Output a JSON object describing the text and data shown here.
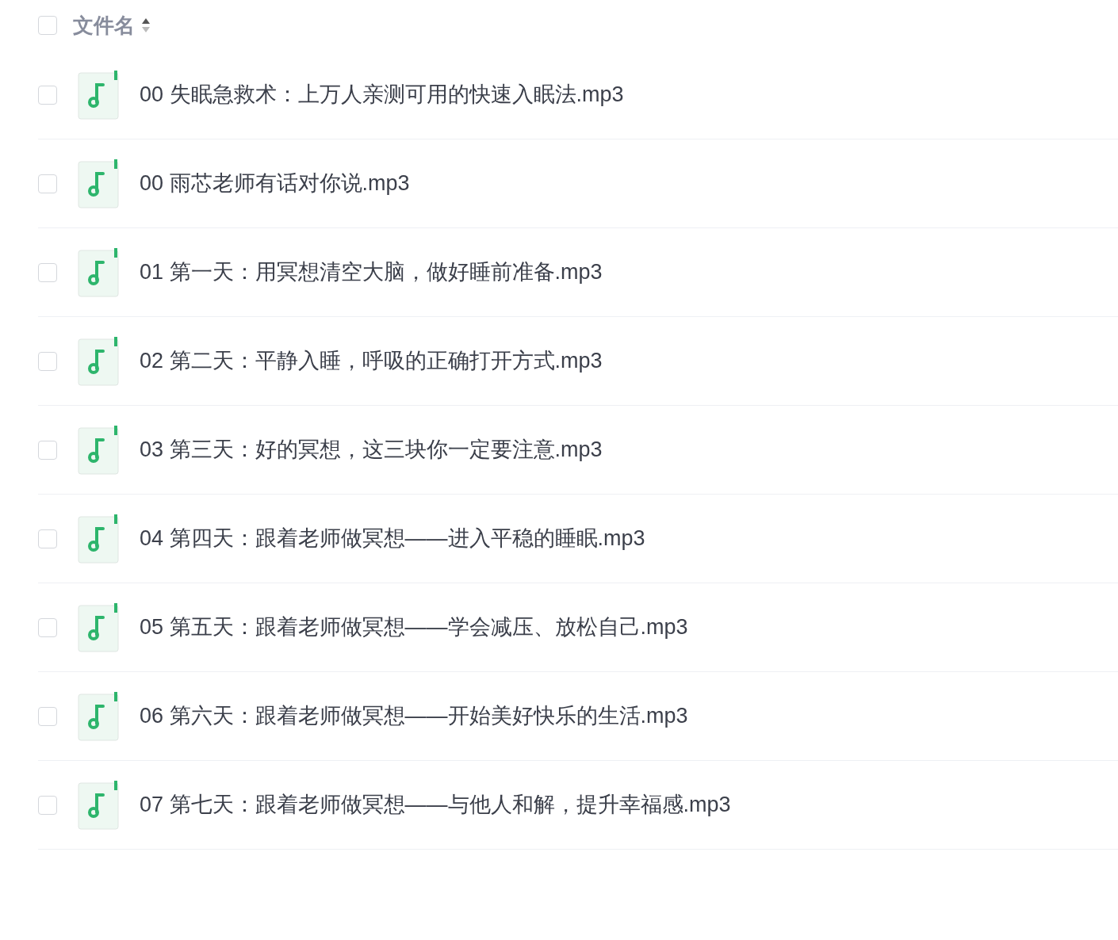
{
  "header": {
    "checked": false,
    "label": "文件名"
  },
  "files": [
    {
      "name": "00 失眠急救术：上万人亲测可用的快速入眠法.mp3",
      "checked": false
    },
    {
      "name": "00 雨芯老师有话对你说.mp3",
      "checked": false
    },
    {
      "name": "01 第一天：用冥想清空大脑，做好睡前准备.mp3",
      "checked": false
    },
    {
      "name": "02 第二天：平静入睡，呼吸的正确打开方式.mp3",
      "checked": false
    },
    {
      "name": "03 第三天：好的冥想，这三块你一定要注意.mp3",
      "checked": false
    },
    {
      "name": "04 第四天：跟着老师做冥想——进入平稳的睡眠.mp3",
      "checked": false
    },
    {
      "name": "05 第五天：跟着老师做冥想——学会减压、放松自己.mp3",
      "checked": false
    },
    {
      "name": "06 第六天：跟着老师做冥想——开始美好快乐的生活.mp3",
      "checked": false
    },
    {
      "name": "07 第七天：跟着老师做冥想——与他人和解，提升幸福感.mp3",
      "checked": false
    }
  ]
}
